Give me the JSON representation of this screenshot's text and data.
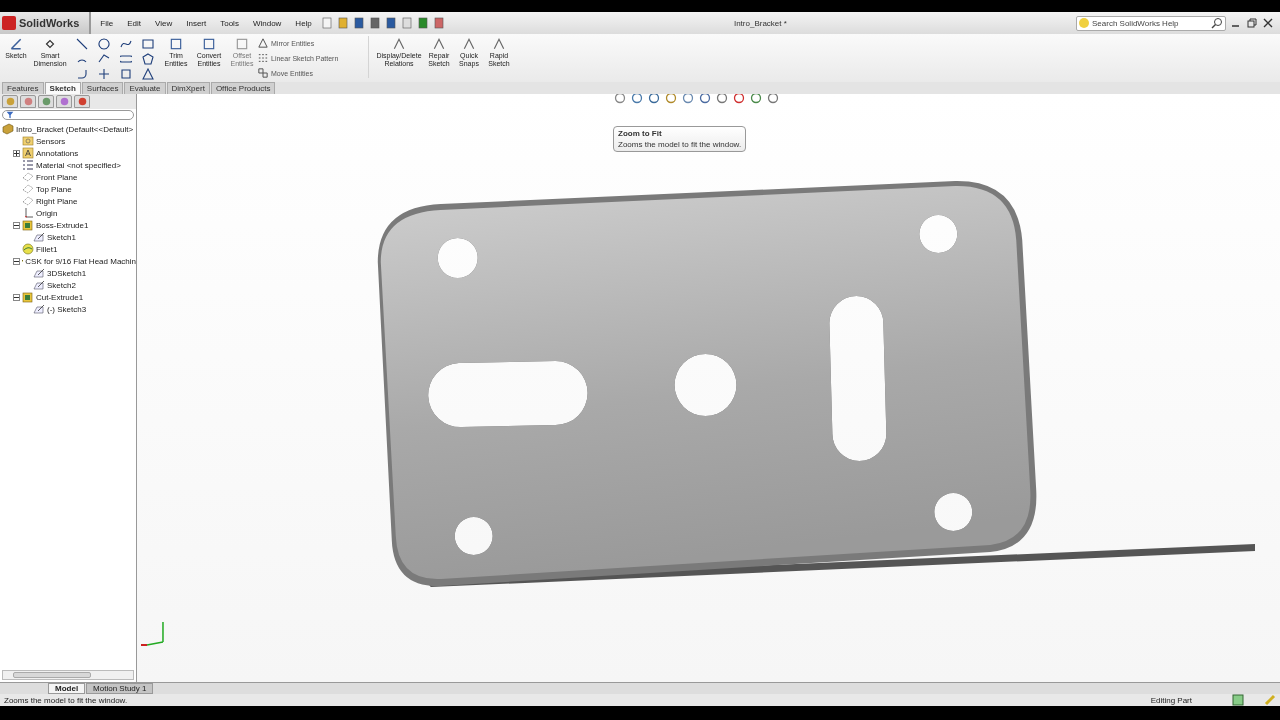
{
  "app": {
    "logo": "SolidWorks",
    "menu": [
      "File",
      "Edit",
      "View",
      "Insert",
      "Tools",
      "Window",
      "Help"
    ],
    "document_title": "Intro_Bracket *",
    "search": {
      "placeholder": "Search SolidWorks Help"
    }
  },
  "ribbon": {
    "left": [
      {
        "label": "Sketch",
        "disabled": false
      },
      {
        "label": "Smart Dimension",
        "disabled": false
      }
    ],
    "middle": [
      {
        "label": "Trim Entities",
        "disabled": false
      },
      {
        "label": "Convert Entities",
        "disabled": false
      },
      {
        "label": "Offset Entities",
        "disabled": true
      }
    ],
    "small": [
      {
        "label": "Mirror Entities"
      },
      {
        "label": "Linear Sketch Pattern"
      },
      {
        "label": "Move Entities"
      }
    ],
    "right": [
      {
        "label": "Display/Delete Relations",
        "disabled": false
      },
      {
        "label": "Repair Sketch",
        "disabled": false
      },
      {
        "label": "Quick Snaps",
        "disabled": false
      },
      {
        "label": "Rapid Sketch",
        "disabled": false
      }
    ]
  },
  "tabs": [
    {
      "label": "Features",
      "selected": false
    },
    {
      "label": "Sketch",
      "selected": true
    },
    {
      "label": "Surfaces",
      "selected": false
    },
    {
      "label": "Evaluate",
      "selected": false
    },
    {
      "label": "DimXpert",
      "selected": false
    },
    {
      "label": "Office Products",
      "selected": false
    }
  ],
  "tree": {
    "label": "Intro_Bracket  (Default<<Default>",
    "kind": "part",
    "children": [
      {
        "label": "Sensors",
        "kind": "sensor"
      },
      {
        "label": "Annotations",
        "kind": "annotation",
        "expanded": false
      },
      {
        "label": "Material <not specified>",
        "kind": "material"
      },
      {
        "label": "Front Plane",
        "kind": "plane"
      },
      {
        "label": "Top Plane",
        "kind": "plane"
      },
      {
        "label": "Right Plane",
        "kind": "plane"
      },
      {
        "label": "Origin",
        "kind": "origin"
      },
      {
        "label": "Boss-Extrude1",
        "kind": "feature",
        "expanded": true,
        "children": [
          {
            "label": "Sketch1",
            "kind": "sketch"
          }
        ]
      },
      {
        "label": "Fillet1",
        "kind": "fillet"
      },
      {
        "label": "CSK for 9/16 Flat Head Machin",
        "kind": "feature",
        "expanded": true,
        "children": [
          {
            "label": "3DSketch1",
            "kind": "sketch"
          },
          {
            "label": "Sketch2",
            "kind": "sketch"
          }
        ]
      },
      {
        "label": "Cut-Extrude1",
        "kind": "feature",
        "expanded": true,
        "children": [
          {
            "label": "(-) Sketch3",
            "kind": "sketch"
          }
        ]
      }
    ]
  },
  "tooltip": {
    "title": "Zoom to Fit",
    "body": "Zooms the model to fit the window."
  },
  "bottom_tabs": [
    {
      "label": "Model",
      "selected": true
    },
    {
      "label": "Motion Study 1",
      "selected": false
    }
  ],
  "status_bar": {
    "message": "Zooms the model to fit the window.",
    "mode": "Editing Part"
  }
}
